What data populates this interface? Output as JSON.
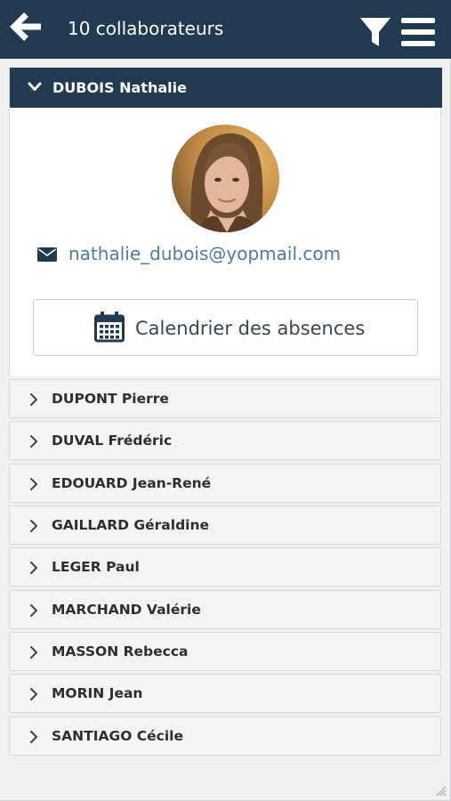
{
  "header": {
    "title": "10 collaborateurs",
    "icons": {
      "back": "arrow-left-icon",
      "filter": "filter-icon",
      "menu": "hamburger-menu-icon"
    },
    "bar_color": "#213a4f"
  },
  "expanded_person": {
    "name": "DUBOIS Nathalie",
    "email": "nathalie_dubois@yopmail.com",
    "calendar_button_label": "Calendrier des absences",
    "icons": {
      "chevron": "chevron-down-icon",
      "email": "envelope-icon",
      "calendar": "calendar-icon",
      "photo": "profile-photo"
    }
  },
  "people": [
    {
      "name": "DUPONT Pierre"
    },
    {
      "name": "DUVAL Frédéric"
    },
    {
      "name": "EDOUARD Jean-René"
    },
    {
      "name": "GAILLARD Géraldine"
    },
    {
      "name": "LEGER Paul"
    },
    {
      "name": "MARCHAND Valérie"
    },
    {
      "name": "MASSON Rebecca"
    },
    {
      "name": "MORIN Jean"
    },
    {
      "name": "SANTIAGO Cécile"
    }
  ],
  "colors": {
    "accent": "#213a4f",
    "link": "#4d7ba3",
    "row_background": "#f4f4f4"
  }
}
